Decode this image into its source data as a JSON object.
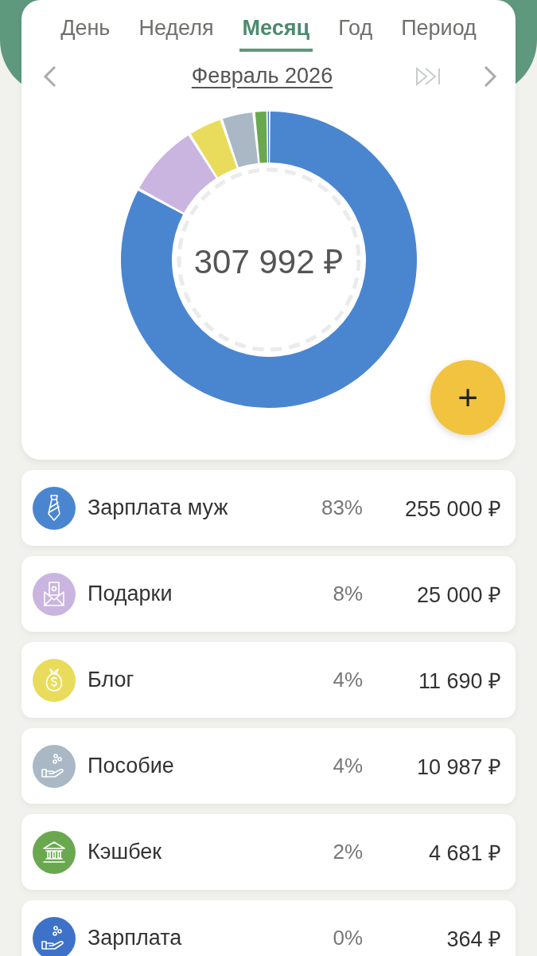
{
  "tabs": [
    {
      "label": "День",
      "selected": false
    },
    {
      "label": "Неделя",
      "selected": false
    },
    {
      "label": "Месяц",
      "selected": true
    },
    {
      "label": "Год",
      "selected": false
    },
    {
      "label": "Период",
      "selected": false
    }
  ],
  "period": {
    "label": "Февраль 2026"
  },
  "chart_data": {
    "type": "donut",
    "values": [
      82.87,
      8.12,
      3.8,
      3.57,
      1.52,
      0.12
    ]
  },
  "total": "307 992 ₽",
  "add_button": "+",
  "items": [
    {
      "name": "Зарплата муж",
      "percent": "83%",
      "amount": "255 000 ₽",
      "color": "#4a86d0"
    },
    {
      "name": "Подарки",
      "percent": "8%",
      "amount": "25 000 ₽",
      "color": "#c9b5e0"
    },
    {
      "name": "Блог",
      "percent": "4%",
      "amount": "11 690 ₽",
      "color": "#e9dc5c"
    },
    {
      "name": "Пособие",
      "percent": "4%",
      "amount": "10 987 ₽",
      "color": "#a9b8c4"
    },
    {
      "name": "Кэшбек",
      "percent": "2%",
      "amount": "4 681 ₽",
      "color": "#6aa84f"
    },
    {
      "name": "Зарплата",
      "percent": "0%",
      "amount": "364 ₽",
      "color": "#3d72c8"
    }
  ]
}
